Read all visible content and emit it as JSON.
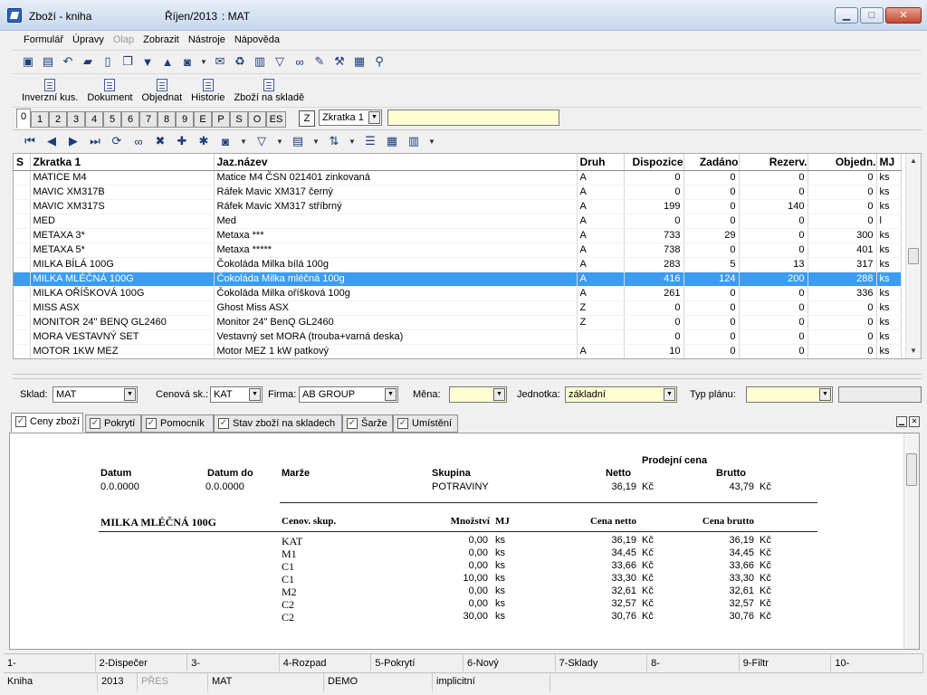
{
  "title": {
    "window": "Zboží - kniha",
    "period": "Říjen/2013",
    "stock": ": MAT"
  },
  "window_buttons": {
    "minimize": "▁",
    "maximize": "□",
    "close": "✕"
  },
  "menu": [
    "Formulář",
    "Úpravy",
    "Olap",
    "Zobrazit",
    "Nástroje",
    "Nápověda"
  ],
  "menu_disabled": "Olap",
  "actions": [
    "Inverzní kus.",
    "Dokument",
    "Objednat",
    "Historie",
    "Zboží na skladě"
  ],
  "tabs": [
    "0",
    "1",
    "2",
    "3",
    "4",
    "5",
    "6",
    "7",
    "8",
    "9",
    "E",
    "P",
    "S",
    "O",
    "ES"
  ],
  "z_button": "Z",
  "shortcut_select": "Zkratka 1",
  "grid": {
    "columns": [
      "S",
      "Zkratka 1",
      "Jaz.název",
      "Druh",
      "Dispozice",
      "Zadáno",
      "Rezerv.",
      "Objedn.",
      "MJ"
    ],
    "rows": [
      [
        "",
        "MATICE M4",
        "Matice M4 ČSN 021401 zinkovaná",
        "A",
        "0",
        "0",
        "0",
        "0",
        "ks"
      ],
      [
        "",
        "MAVIC XM317B",
        "Ráfek Mavic XM317 černý",
        "A",
        "0",
        "0",
        "0",
        "0",
        "ks"
      ],
      [
        "",
        "MAVIC XM317S",
        "Ráfek Mavic XM317 stříbrný",
        "A",
        "199",
        "0",
        "140",
        "0",
        "ks"
      ],
      [
        "",
        "MED",
        "Med",
        "A",
        "0",
        "0",
        "0",
        "0",
        "l"
      ],
      [
        "",
        "METAXA 3*",
        "Metaxa ***",
        "A",
        "733",
        "29",
        "0",
        "300",
        "ks"
      ],
      [
        "",
        "METAXA 5*",
        "Metaxa *****",
        "A",
        "738",
        "0",
        "0",
        "401",
        "ks"
      ],
      [
        "",
        "MILKA BÍLÁ 100G",
        "Čokoláda Milka bílá 100g",
        "A",
        "283",
        "5",
        "13",
        "317",
        "ks"
      ],
      [
        "",
        "MILKA MLÉČNÁ 100G",
        "Čokoláda Milka mléčná 100g",
        "A",
        "416",
        "124",
        "200",
        "288",
        "ks"
      ],
      [
        "",
        "MILKA OŘÍŠKOVÁ 100G",
        "Čokoláda Milka oříšková 100g",
        "A",
        "261",
        "0",
        "0",
        "336",
        "ks"
      ],
      [
        "",
        "MISS ASX",
        "Ghost Miss ASX",
        "Z",
        "0",
        "0",
        "0",
        "0",
        "ks"
      ],
      [
        "",
        "MONITOR 24\" BENQ GL2460",
        "Monitor 24\" BenQ GL2460",
        "Z",
        "0",
        "0",
        "0",
        "0",
        "ks"
      ],
      [
        "",
        "MORA VESTAVNÝ SET",
        "Vestavný set MORA (trouba+varná deska)",
        "",
        "0",
        "0",
        "0",
        "0",
        "ks"
      ],
      [
        "",
        "MOTOR  1KW MEZ",
        "Motor MEZ 1 kW patkový",
        "A",
        "10",
        "0",
        "0",
        "0",
        "ks"
      ]
    ],
    "selected_row": 7
  },
  "filters": {
    "sklad": {
      "label": "Sklad:",
      "value": "MAT"
    },
    "cenova": {
      "label": "Cenová sk.:",
      "value": "KAT"
    },
    "firma": {
      "label": "Firma:",
      "value": "AB GROUP"
    },
    "mena": {
      "label": "Měna:",
      "value": ""
    },
    "jednotka": {
      "label": "Jednotka:",
      "value": "základní"
    },
    "typ": {
      "label": "Typ plánu:",
      "value": ""
    }
  },
  "bottom_tabs": [
    "Ceny zboží",
    "Pokrytí",
    "Pomocník",
    "Stav zboží na skladech",
    "Šarže",
    "Umístění"
  ],
  "detail": {
    "prodejni_cena": "Prodejní cena",
    "h_datum": "Datum",
    "h_datum_do": "Datum do",
    "h_marze": "Marže",
    "h_skupina": "Skupina",
    "h_netto": "Netto",
    "h_brutto": "Brutto",
    "datum": "0.0.0000",
    "datum_do": "0.0.0000",
    "skupina": "POTRAVINY",
    "netto": "36,19",
    "netto_cur": "Kč",
    "brutto": "43,79",
    "brutto_cur": "Kč",
    "item": "MILKA MLÉČNÁ 100G",
    "h_cenov": "Cenov. skup.",
    "h_mnozstvi": "Množství",
    "h_mj": "MJ",
    "h_cena_netto": "Cena netto",
    "h_cena_brutto": "Cena brutto",
    "rows": [
      [
        "KAT",
        "0,00",
        "ks",
        "36,19",
        "Kč",
        "36,19",
        "Kč"
      ],
      [
        "M1",
        "0,00",
        "ks",
        "34,45",
        "Kč",
        "34,45",
        "Kč"
      ],
      [
        "C1",
        "0,00",
        "ks",
        "33,66",
        "Kč",
        "33,66",
        "Kč"
      ],
      [
        "C1",
        "10,00",
        "ks",
        "33,30",
        "Kč",
        "33,30",
        "Kč"
      ],
      [
        "M2",
        "0,00",
        "ks",
        "32,61",
        "Kč",
        "32,61",
        "Kč"
      ],
      [
        "C2",
        "0,00",
        "ks",
        "32,57",
        "Kč",
        "32,57",
        "Kč"
      ],
      [
        "C2",
        "30,00",
        "ks",
        "30,76",
        "Kč",
        "30,76",
        "Kč"
      ]
    ]
  },
  "fkeys": [
    "1-",
    "2-Dispečer",
    "3-",
    "4-Rozpad",
    "5-Pokrytí",
    "6-Nový",
    "7-Sklady",
    "8-",
    "9-Filtr",
    "10-"
  ],
  "status": {
    "module": "Kniha",
    "year": "2013",
    "pres": "PŘES",
    "stock": "MAT",
    "db": "DEMO",
    "mode": "implicitní"
  },
  "colors": {
    "selection": "#3c9cf0",
    "highlight_input": "#ffffd2",
    "title_gradient": "#c7d8ee"
  }
}
